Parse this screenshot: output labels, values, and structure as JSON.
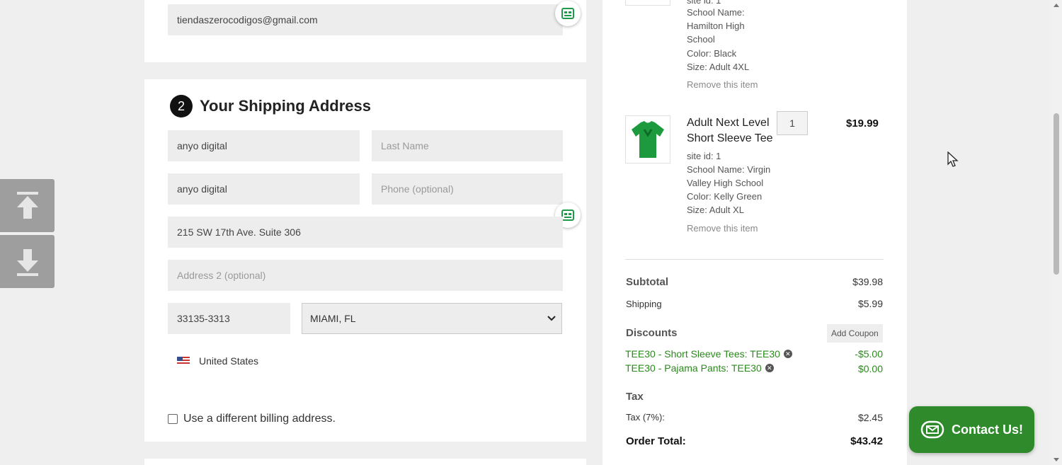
{
  "contact_section": {
    "email_value": "tiendaszerocodigos@gmail.com"
  },
  "shipping": {
    "step_number": "2",
    "title": "Your Shipping Address",
    "first_name": "anyo digital",
    "last_name_placeholder": "Last Name",
    "company": "anyo digital",
    "phone_placeholder": "Phone (optional)",
    "address1": "215 SW 17th Ave. Suite 306",
    "address2_placeholder": "Address 2 (optional)",
    "zip": "33135-3313",
    "city_state": "MIAMI, FL",
    "country": "United States",
    "billing_checkbox_label": "Use a different billing address."
  },
  "cart": {
    "item1": {
      "partial_line": "site id: 1",
      "school_label_1": "School Name:",
      "school_label_2": "Hamilton High",
      "school_label_3": "School",
      "color": "Color: Black",
      "size": "Size: Adult 4XL",
      "remove": "Remove this item",
      "shirt_color": "#111111"
    },
    "item2": {
      "name_line1": "Adult Next Level",
      "name_line2": "Short Sleeve Tee",
      "qty": "1",
      "price": "$19.99",
      "site_id": "site id: 1",
      "school_1": "School Name: Virgin",
      "school_2": "Valley High School",
      "color": "Color: Kelly Green",
      "size": "Size: Adult XL",
      "remove": "Remove this item",
      "shirt_color": "#1e9a3e"
    }
  },
  "totals": {
    "subtotal_label": "Subtotal",
    "subtotal_value": "$39.98",
    "shipping_label": "Shipping",
    "shipping_value": "$5.99",
    "discounts_label": "Discounts",
    "add_coupon": "Add Coupon",
    "discount1_label": "TEE30 - Short Sleeve Tees: TEE30",
    "discount1_value": "-$5.00",
    "discount2_label": "TEE30 - Pajama Pants: TEE30",
    "discount2_value": "$0.00",
    "tax_heading": "Tax",
    "tax_label": "Tax (7%):",
    "tax_value": "$2.45",
    "order_total_label": "Order Total:",
    "order_total_value": "$43.42"
  },
  "contact_button": {
    "label": "Contact Us!"
  },
  "colors": {
    "accent_green": "#2e8a2a",
    "discount_green": "#2a8a1c",
    "autofill_green": "#1f9a4b"
  },
  "icons": [
    "arrow-up-icon",
    "arrow-down-icon",
    "autofill-icon",
    "envelope-icon",
    "close-circle-icon",
    "flag-us-icon",
    "chevron-down-icon",
    "mouse-cursor-icon"
  ]
}
